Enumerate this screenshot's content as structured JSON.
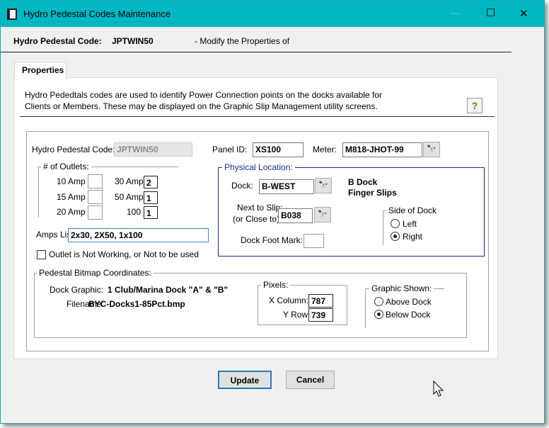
{
  "window": {
    "title": "Hydro Pedestal Codes Maintenance",
    "minimize": "—",
    "maximize": "☐",
    "close": "✕",
    "title_bar_color": "#00b7c3"
  },
  "header": {
    "label": "Hydro Pedestal Code:",
    "code": "JPTWIN50",
    "subtitle": "- Modify the Properties of"
  },
  "tab": {
    "label": "Properties"
  },
  "description": {
    "line1": "Hydro Pededtals codes are used to identify Power Connection points on the docks available for",
    "line2": "Clients or Members.  These may be displayed on the Graphic Slip Management utility screens.",
    "help_icon": "help-question-icon"
  },
  "form": {
    "code_label": "Hydro Pedestal Code:",
    "code_value": "JPTWIN50",
    "panel_label": "Panel ID:",
    "panel_value": "XS100",
    "meter_label": "Meter:",
    "meter_value": "M818-JHOT-99",
    "outlets": {
      "legend": "# of Outlets:",
      "a10": "10 Amp",
      "v10": "",
      "a15": "15 Amp",
      "v15": "",
      "a20": "20 Amp",
      "v20": "",
      "a30": "30 Amp",
      "v30": "2",
      "a50": "50 Amp",
      "v50": "1",
      "a100": "100",
      "v100": "1"
    },
    "amps_label": "Amps List:",
    "amps_value": "2x30,  2X50, 1x100",
    "not_working_label": "Outlet is Not Working, or Not to be used",
    "not_working_checked": false,
    "location": {
      "legend": "Physical Location:",
      "dock_label": "Dock:",
      "dock_value": "B-WEST",
      "dock_desc1": "B Dock",
      "dock_desc2": "Finger Slips",
      "slip_label1": "Next to Slip:",
      "slip_label2": "(or Close to)",
      "slip_value": "B038",
      "foot_label": "Dock Foot Mark:",
      "foot_value": "",
      "side_legend": "Side of Dock",
      "side_left": "Left",
      "side_right": "Right",
      "side_selected": "Right",
      "border_color": "#1c2a8c"
    },
    "bitmap": {
      "legend": "Pedestal Bitmap Coordinates:",
      "graphic_label": "Dock Graphic:",
      "graphic_value": "1  Club/Marina Dock \"A\" & \"B\"",
      "file_label": "Filename:",
      "file_value": "BYC-Docks1-85Pct.bmp",
      "pixels_legend": "Pixels:",
      "x_label": "X Column:",
      "x_value": "787",
      "y_label": "Y Row:",
      "y_value": "739",
      "shown_legend": "Graphic Shown:",
      "above": "Above Dock",
      "below": "Below Dock",
      "shown_selected": "Below Dock"
    }
  },
  "buttons": {
    "update": "Update",
    "cancel": "Cancel"
  }
}
